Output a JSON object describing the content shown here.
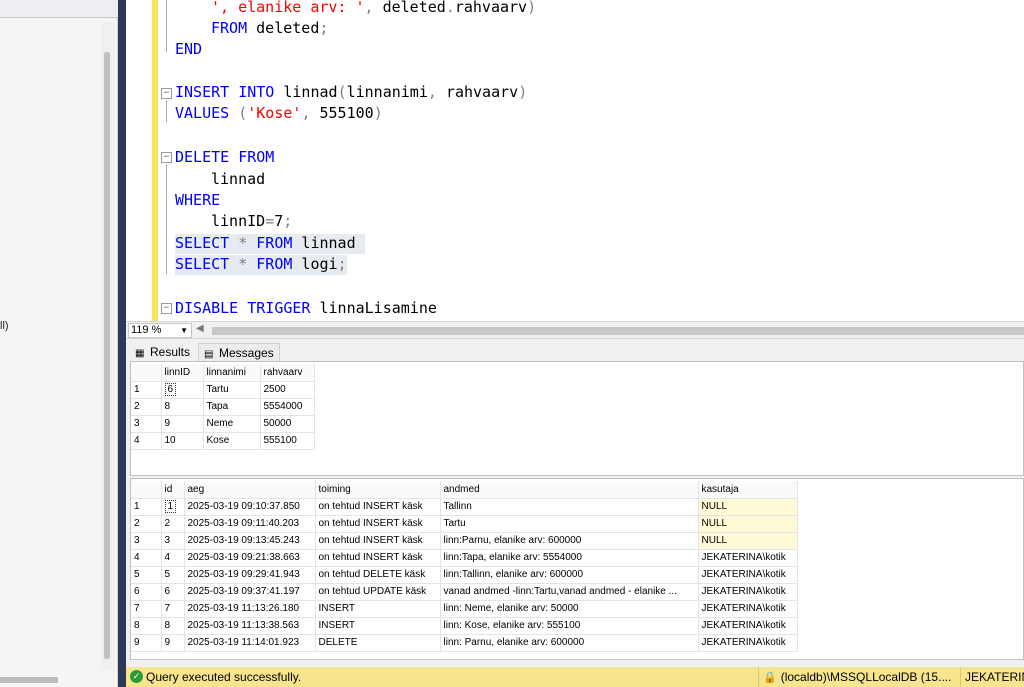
{
  "left_pane": {
    "tree_fragment": "ll)"
  },
  "editor": {
    "lines": [
      {
        "id": "l1",
        "parts": [
          [
            "str",
            "', elanike arv: '"
          ],
          [
            "gray",
            ", "
          ],
          [
            "plain",
            "deleted"
          ],
          [
            "gray",
            "."
          ],
          [
            "plain",
            "rahvaarv"
          ],
          [
            "gray",
            ")"
          ]
        ]
      },
      {
        "id": "l2",
        "parts": [
          [
            "kw",
            "FROM"
          ],
          [
            "plain",
            " deleted"
          ],
          [
            "gray",
            ";"
          ]
        ]
      },
      {
        "id": "l3",
        "parts": [
          [
            "kw",
            "END"
          ]
        ]
      },
      {
        "id": "l4",
        "parts": [
          [
            "kw",
            "INSERT INTO"
          ],
          [
            "plain",
            " linnad"
          ],
          [
            "gray",
            "("
          ],
          [
            "plain",
            "linnanimi"
          ],
          [
            "gray",
            ", "
          ],
          [
            "plain",
            "rahvaarv"
          ],
          [
            "gray",
            ")"
          ]
        ]
      },
      {
        "id": "l5",
        "parts": [
          [
            "kw",
            "VALUES"
          ],
          [
            "plain",
            " "
          ],
          [
            "gray",
            "("
          ],
          [
            "str",
            "'Kose'"
          ],
          [
            "gray",
            ", "
          ],
          [
            "plain",
            "555100"
          ],
          [
            "gray",
            ")"
          ]
        ]
      },
      {
        "id": "l6",
        "parts": [
          [
            "kw",
            "DELETE FROM"
          ]
        ]
      },
      {
        "id": "l7",
        "parts": [
          [
            "plain",
            "linnad"
          ]
        ]
      },
      {
        "id": "l8",
        "parts": [
          [
            "kw",
            "WHERE"
          ]
        ]
      },
      {
        "id": "l9",
        "parts": [
          [
            "plain",
            "linnID"
          ],
          [
            "gray",
            "="
          ],
          [
            "plain",
            "7"
          ],
          [
            "gray",
            ";"
          ]
        ]
      },
      {
        "id": "l10",
        "parts": [
          [
            "kw",
            "SELECT"
          ],
          [
            "plain",
            " "
          ],
          [
            "gray",
            "*"
          ],
          [
            "plain",
            " "
          ],
          [
            "kw",
            "FROM"
          ],
          [
            "plain",
            " linnad "
          ]
        ]
      },
      {
        "id": "l11",
        "parts": [
          [
            "kw",
            "SELECT"
          ],
          [
            "plain",
            " "
          ],
          [
            "gray",
            "*"
          ],
          [
            "plain",
            " "
          ],
          [
            "kw",
            "FROM"
          ],
          [
            "plain",
            " logi"
          ],
          [
            "gray",
            ";"
          ]
        ]
      },
      {
        "id": "l12",
        "parts": [
          [
            "kw",
            "DISABLE TRIGGER"
          ],
          [
            "plain",
            " linnaLisamine"
          ]
        ]
      }
    ]
  },
  "zoom": {
    "value": "119 %"
  },
  "tabs": {
    "results": "Results",
    "messages": "Messages"
  },
  "grid1": {
    "columns": [
      "linnID",
      "linnanimi",
      "rahvaarv"
    ],
    "rows": [
      [
        "1",
        "6",
        "Tartu",
        "2500"
      ],
      [
        "2",
        "8",
        "Tapa",
        "5554000"
      ],
      [
        "3",
        "9",
        "Neme",
        "50000"
      ],
      [
        "4",
        "10",
        "Kose",
        "555100"
      ]
    ]
  },
  "grid2": {
    "columns": [
      "id",
      "aeg",
      "toiming",
      "andmed",
      "kasutaja"
    ],
    "rows": [
      [
        "1",
        "1",
        "2025-03-19 09:10:37.850",
        "on tehtud INSERT käsk",
        "Tallinn",
        "NULL"
      ],
      [
        "2",
        "2",
        "2025-03-19 09:11:40.203",
        "on tehtud INSERT käsk",
        "Tartu",
        "NULL"
      ],
      [
        "3",
        "3",
        "2025-03-19 09:13:45.243",
        "on tehtud INSERT käsk",
        "linn:Parnu, elanike arv: 600000",
        "NULL"
      ],
      [
        "4",
        "4",
        "2025-03-19 09:21:38.663",
        "on tehtud INSERT käsk",
        "linn:Tapa, elanike arv: 5554000",
        "JEKATERINA\\kotik"
      ],
      [
        "5",
        "5",
        "2025-03-19 09:29:41.943",
        "on tehtud DELETE käsk",
        "linn:Tallinn, elanike arv: 600000",
        "JEKATERINA\\kotik"
      ],
      [
        "6",
        "6",
        "2025-03-19 09:37:41.197",
        "on tehtud UPDATE käsk",
        "vanad andmed -linn:Tartu,vanad andmed - elanike ...",
        "JEKATERINA\\kotik"
      ],
      [
        "7",
        "7",
        "2025-03-19 11:13:26.180",
        "INSERT",
        "linn: Neme, elanike arv: 50000",
        "JEKATERINA\\kotik"
      ],
      [
        "8",
        "8",
        "2025-03-19 11:13:38.563",
        "INSERT",
        "linn: Kose, elanike arv: 555100",
        "JEKATERINA\\kotik"
      ],
      [
        "9",
        "9",
        "2025-03-19 11:14:01.923",
        "DELETE",
        "linn: Parnu, elanike arv: 600000",
        "JEKATERINA\\kotik"
      ]
    ]
  },
  "status": {
    "message": "Query executed successfully.",
    "server": "(localdb)\\MSSQLLocalDB (15....",
    "user": "JEKATERIN"
  },
  "colors": {
    "status_bg": "#f6e58d",
    "keyword": "#0000ff",
    "string": "#ff0000",
    "selection": "#e5ebf1"
  },
  "icons": {
    "ok": "check-circle-icon",
    "lock": "lock-icon",
    "grid": "grid-icon",
    "messages": "messages-icon"
  }
}
